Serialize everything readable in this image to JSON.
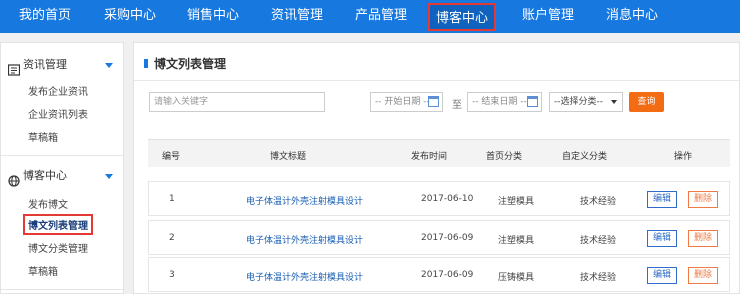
{
  "nav": {
    "items": [
      "我的首页",
      "采购中心",
      "销售中心",
      "资讯管理",
      "产品管理",
      "博客中心",
      "账户管理",
      "消息中心"
    ],
    "active": "博客中心"
  },
  "sidebar": {
    "sections": [
      {
        "title": "资讯管理",
        "links": [
          "发布企业资讯",
          "企业资讯列表",
          "草稿箱"
        ]
      },
      {
        "title": "博客中心",
        "links": [
          "发布博文",
          "博文列表管理",
          "博文分类管理",
          "草稿箱"
        ]
      }
    ],
    "active_link": "博文列表管理"
  },
  "main": {
    "title": "博文列表管理",
    "filters": {
      "keyword_placeholder": "请输入关键字",
      "start_date": "-- 开始日期 --",
      "to": "至",
      "end_date": "-- 结束日期 --",
      "category": "--选择分类--",
      "query": "查询"
    },
    "columns": [
      "编号",
      "博文标题",
      "发布时间",
      "首页分类",
      "自定义分类",
      "操作"
    ],
    "rows": [
      {
        "id": "1",
        "title": "电子体温计外壳注射模具设计",
        "date": "2017-06-10",
        "home_cat": "注塑模具",
        "custom_cat": "技术经验"
      },
      {
        "id": "2",
        "title": "电子体温计外壳注射模具设计",
        "date": "2017-06-09",
        "home_cat": "注塑模具",
        "custom_cat": "技术经验"
      },
      {
        "id": "3",
        "title": "电子体温计外壳注射模具设计",
        "date": "2017-06-09",
        "home_cat": "压铸模具",
        "custom_cat": "技术经验"
      }
    ],
    "edit_label": "编辑",
    "delete_label": "删除"
  },
  "colors": {
    "nav_bg": "#1779e0",
    "accent_red": "#e53935",
    "query_orange": "#f36b12",
    "link_blue": "#1a5fb4"
  }
}
